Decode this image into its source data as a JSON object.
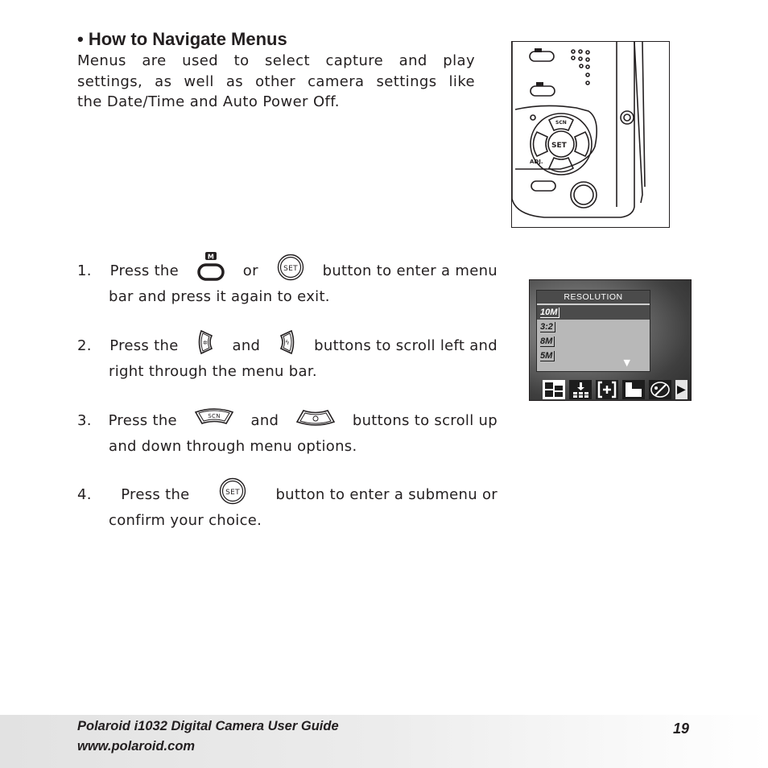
{
  "section": {
    "heading": "• How to Navigate Menus",
    "intro_lines": [
      "Menus are used to select capture and play",
      "settings, as well as other camera settings like",
      "the Date/Time and Auto Power Off."
    ]
  },
  "steps": [
    {
      "number": "1.",
      "line1_a": "Press the",
      "icon1": "menu-m-button-icon",
      "line1_b": "or",
      "icon2": "set-button-icon",
      "line1_c": "button to enter a menu",
      "line2": "bar and press it again to exit."
    },
    {
      "number": "2.",
      "line1_a": "Press the",
      "icon1": "left-button-icon",
      "line1_b": "and",
      "icon2": "right-button-icon",
      "line1_c": "buttons to scroll left and",
      "line2": "right through the menu bar."
    },
    {
      "number": "3.",
      "line1_a": "Press the",
      "icon1": "scn-up-button-icon",
      "icon1_label": "SCN",
      "line1_b": "and",
      "icon2": "down-timer-button-icon",
      "line1_c": "buttons to scroll up",
      "line2": "and down through menu options."
    },
    {
      "number": "4.",
      "line1_a": "Press the",
      "icon1": "set-button-icon",
      "line1_c": "button to enter a submenu or",
      "line2": "confirm your choice."
    }
  ],
  "icons": {
    "m_label": "M",
    "set_label": "SET",
    "scn_label": "SCN"
  },
  "camera_illustration": {
    "labels": {
      "scn": "SCN",
      "set": "SET",
      "adj": "ADJ."
    }
  },
  "lcd_screen": {
    "menu_title": "RESOLUTION",
    "options": [
      {
        "label": "10M",
        "selected": true
      },
      {
        "label": "3:2",
        "selected": false
      },
      {
        "label": "8M",
        "selected": false
      },
      {
        "label": "5M",
        "selected": false
      }
    ],
    "scroll_indicator": "▼",
    "iconbar": [
      {
        "name": "resolution-icon",
        "selected": true
      },
      {
        "name": "quality-icon",
        "selected": false
      },
      {
        "name": "metering-icon",
        "selected": false
      },
      {
        "name": "exposure-icon",
        "selected": false
      },
      {
        "name": "color-effect-icon",
        "selected": false
      }
    ],
    "next_arrow": "▶"
  },
  "footer": {
    "title": "Polaroid i1032 Digital Camera User Guide",
    "url": "www.polaroid.com",
    "page_number": "19"
  }
}
